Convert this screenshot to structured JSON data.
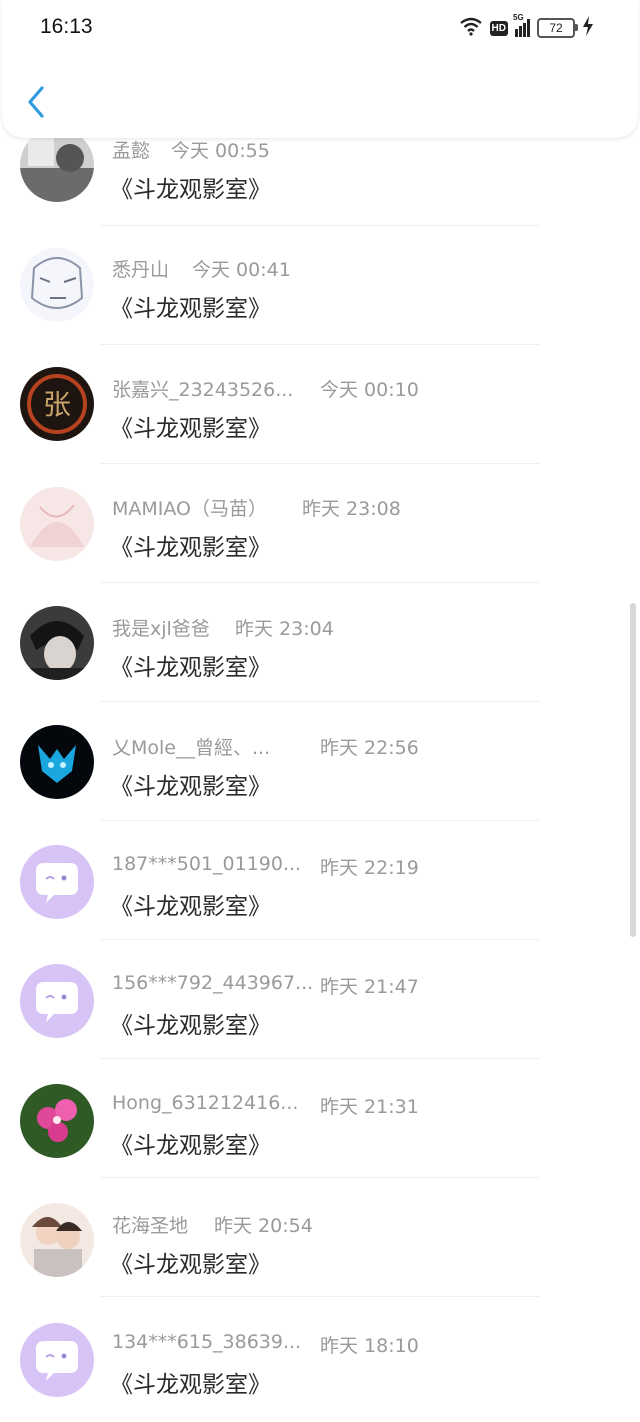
{
  "status_bar": {
    "time": "16:13",
    "network": "5G",
    "hd": "HD",
    "battery": "72"
  },
  "header": {
    "back_icon": "chevron-left-icon"
  },
  "colors": {
    "accent": "#2f9be0",
    "meta_text": "#9a9a9a",
    "message_text": "#2b2b2b",
    "bot_avatar_bg": "#d7c3f5"
  },
  "comments": [
    {
      "name": "孟懿",
      "time": "今天 00:55",
      "message": "《斗龙观影室》",
      "avatar": "photo-avatar-gray"
    },
    {
      "name": "悉丹山",
      "time": "今天 00:41",
      "message": "《斗龙观影室》",
      "avatar": "anime-sketch-avatar"
    },
    {
      "name": "张嘉兴_23243526...",
      "time": "今天 00:10",
      "message": "《斗龙观影室》",
      "avatar": "calligraphy-avatar"
    },
    {
      "name": "MAMIAO（马苗）",
      "time": "昨天 23:08",
      "message": "《斗龙观影室》",
      "avatar": "pink-illustration-avatar"
    },
    {
      "name": "我是xjl爸爸",
      "time": "昨天 23:04",
      "message": "《斗龙观影室》",
      "avatar": "dark-anime-avatar"
    },
    {
      "name": "乂Mole__曾經、...",
      "time": "昨天 22:56",
      "message": "《斗龙观影室》",
      "avatar": "blue-dragon-avatar"
    },
    {
      "name": "187***501_01190...",
      "time": "昨天 22:19",
      "message": "《斗龙观影室》",
      "avatar": "default-chat-bubble-avatar"
    },
    {
      "name": "156***792_443967...",
      "time": "昨天 21:47",
      "message": "《斗龙观影室》",
      "avatar": "default-chat-bubble-avatar"
    },
    {
      "name": "Hong_631212416...",
      "time": "昨天 21:31",
      "message": "《斗龙观影室》",
      "avatar": "pink-flower-avatar"
    },
    {
      "name": "花海圣地",
      "time": "昨天 20:54",
      "message": "《斗龙观影室》",
      "avatar": "couple-illustration-avatar"
    },
    {
      "name": "134***615_38639...",
      "time": "昨天 18:10",
      "message": "《斗龙观影室》",
      "avatar": "default-chat-bubble-avatar"
    }
  ]
}
